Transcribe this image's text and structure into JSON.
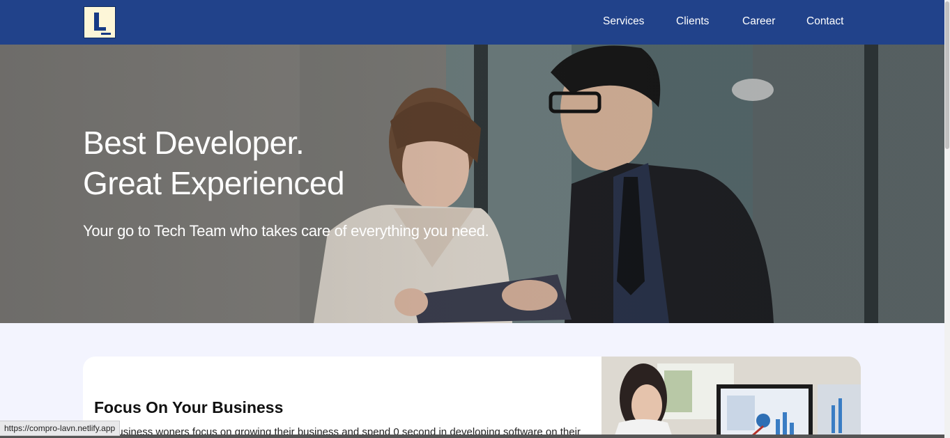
{
  "header": {
    "logo_alt": "L",
    "nav": [
      "Services",
      "Clients",
      "Career",
      "Contact"
    ]
  },
  "hero": {
    "title_line1": "Best Developer.",
    "title_line2": "Great Experienced",
    "subtitle": "Your go to Tech Team who takes care of everything you need."
  },
  "focus": {
    "title": "Focus On Your Business",
    "text": "Let business woners focus on growing their business and spend 0 second in developing software on their"
  },
  "status": {
    "url": "https://compro-lavn.netlify.app"
  },
  "colors": {
    "header_bg": "#21428a",
    "page_bg": "#f3f4fe",
    "logo_bg": "#fdf6d8"
  }
}
